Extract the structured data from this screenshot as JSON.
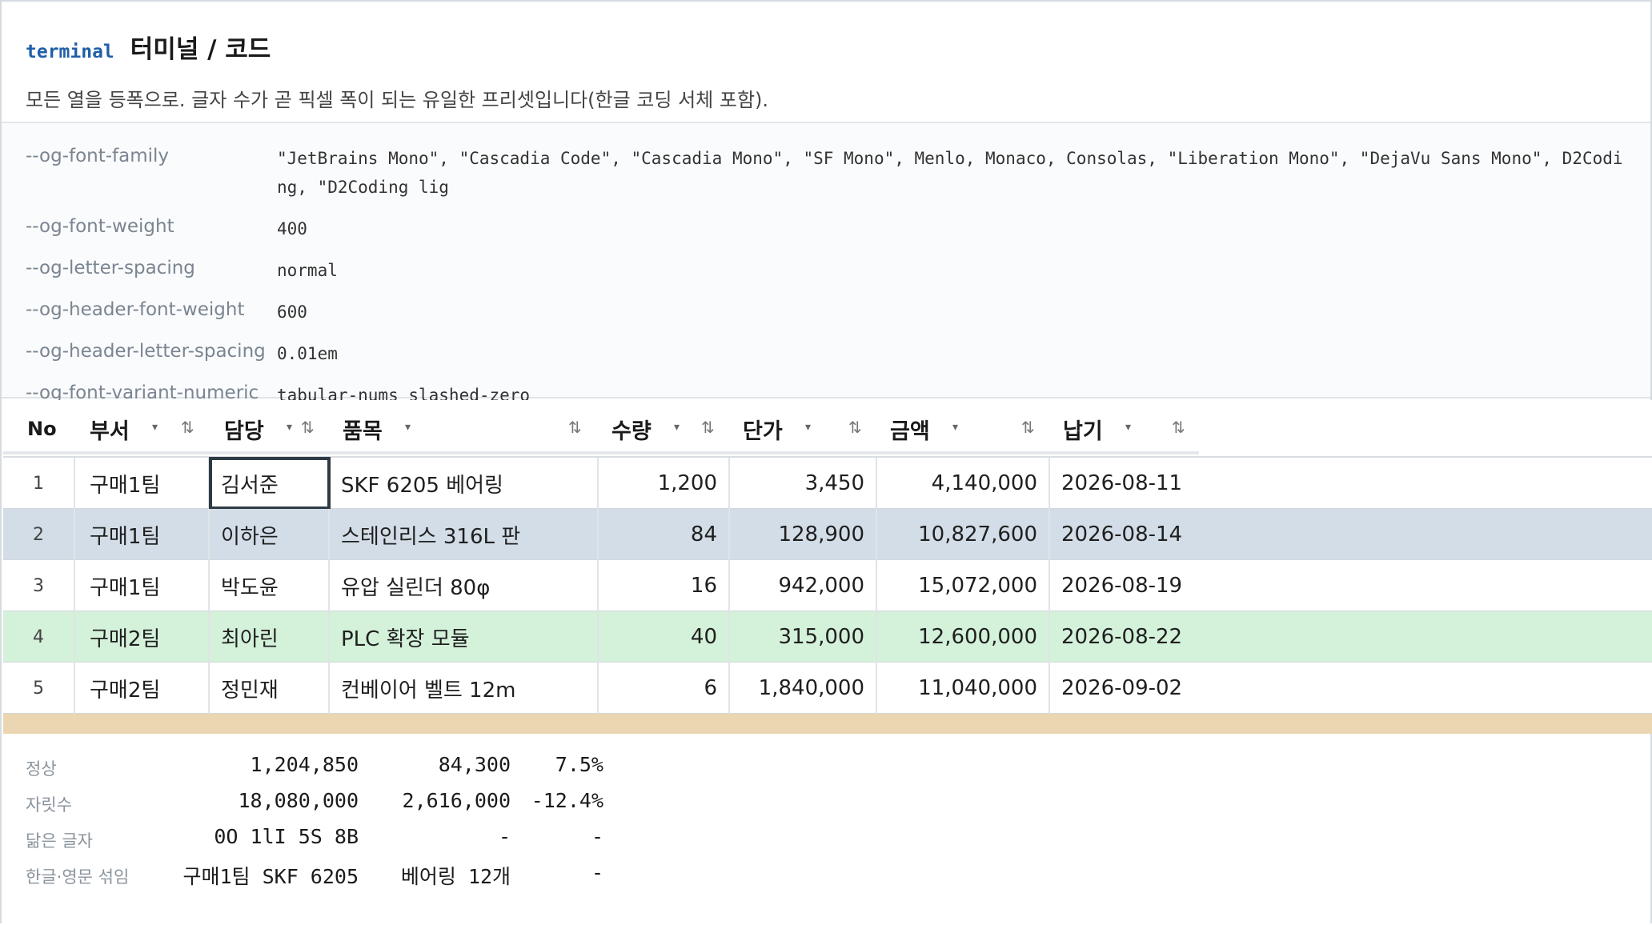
{
  "header": {
    "tag": "terminal",
    "title": "터미널 / 코드",
    "description": "모든 열을 등폭으로. 글자 수가 곧 픽셀 폭이 되는 유일한 프리셋입니다(한글 코딩 서체 포함)."
  },
  "tokens": [
    {
      "key": "--og-font-family",
      "value": "\"JetBrains Mono\", \"Cascadia Code\", \"Cascadia Mono\", \"SF Mono\", Menlo, Monaco, Consolas, \"Liberation Mono\", \"DejaVu Sans Mono\", D2Coding, \"D2Coding lig"
    },
    {
      "key": "--og-font-weight",
      "value": "400"
    },
    {
      "key": "--og-letter-spacing",
      "value": "normal"
    },
    {
      "key": "--og-header-font-weight",
      "value": "600"
    },
    {
      "key": "--og-header-letter-spacing",
      "value": "0.01em"
    },
    {
      "key": "--og-font-variant-numeric",
      "value": "tabular-nums slashed-zero"
    }
  ],
  "grid": {
    "columns": [
      "No",
      "부서",
      "담당",
      "품목",
      "수량",
      "단가",
      "금액",
      "납기"
    ],
    "filter_glyph": "▾",
    "sort_glyph": "⇅",
    "rows": [
      {
        "no": "1",
        "dept": "구매1팀",
        "owner": "김서준",
        "item": "SKF 6205 베어링",
        "qty": "1,200",
        "price": "3,450",
        "amount": "4,140,000",
        "due": "2026-08-11"
      },
      {
        "no": "2",
        "dept": "구매1팀",
        "owner": "이하은",
        "item": "스테인리스 316L 판",
        "qty": "84",
        "price": "128,900",
        "amount": "10,827,600",
        "due": "2026-08-14"
      },
      {
        "no": "3",
        "dept": "구매1팀",
        "owner": "박도윤",
        "item": "유압 실린더 80φ",
        "qty": "16",
        "price": "942,000",
        "amount": "15,072,000",
        "due": "2026-08-19"
      },
      {
        "no": "4",
        "dept": "구매2팀",
        "owner": "최아린",
        "item": "PLC 확장 모듈",
        "qty": "40",
        "price": "315,000",
        "amount": "12,600,000",
        "due": "2026-08-22"
      },
      {
        "no": "5",
        "dept": "구매2팀",
        "owner": "정민재",
        "item": "컨베이어 벨트 12m",
        "qty": "6",
        "price": "1,840,000",
        "amount": "11,040,000",
        "due": "2026-09-02"
      }
    ]
  },
  "samples": [
    {
      "label": "정상",
      "v1": "1,204,850",
      "v2": "84,300",
      "v3": "7.5%"
    },
    {
      "label": "자릿수",
      "v1": "18,080,000",
      "v2": "2,616,000",
      "v3": "-12.4%"
    },
    {
      "label": "닮은 글자",
      "v1": "0O 1lI 5S 8B",
      "v2": "-",
      "v3": "-"
    },
    {
      "label": "한글·영문 섞임",
      "v1": "구매1팀 SKF 6205",
      "v2": "베어링 12개",
      "v3": "-"
    }
  ],
  "colors": {
    "accent": "#1f5fa8",
    "row_selected": "#d2dde7",
    "row_success": "#d4f1da",
    "row_warning": "#ead6b0"
  }
}
